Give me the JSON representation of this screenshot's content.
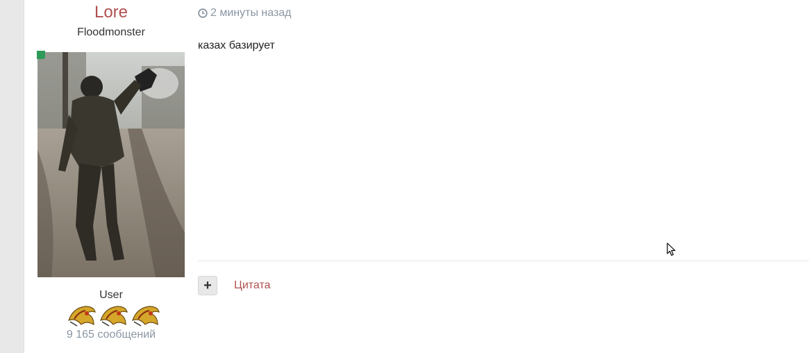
{
  "author": {
    "name": "Lore",
    "title": "Floodmonster",
    "group": "User",
    "post_count": "9 165 сообщений",
    "online": true,
    "avatar_icon": "avatar-photo",
    "rank_icons": [
      "rank-badge-icon",
      "rank-badge-icon",
      "rank-badge-icon"
    ]
  },
  "post": {
    "timestamp": "2 минуты назад",
    "body": "казах базирует"
  },
  "actions": {
    "multiquote_label": "+",
    "quote_label": "Цитата"
  },
  "colors": {
    "accent": "#b05050",
    "muted": "#8a96a3",
    "online": "#2e9a5a"
  }
}
